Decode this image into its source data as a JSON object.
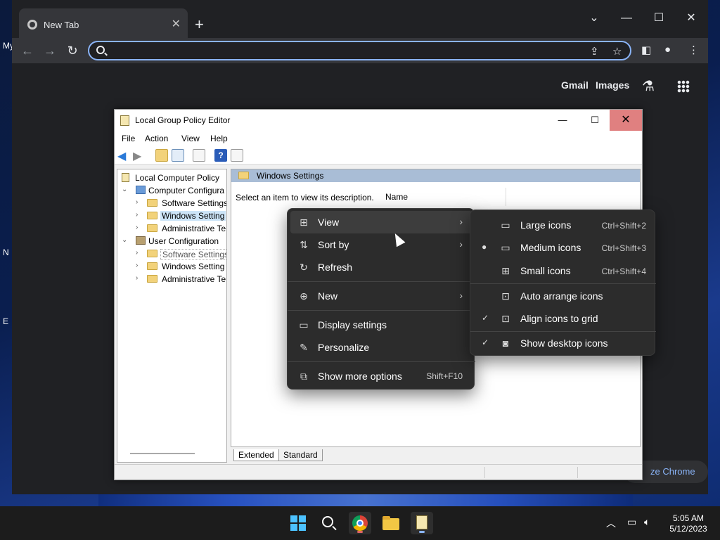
{
  "desktop": {
    "edge_text_1": "My",
    "edge_text_2": "N",
    "edge_text_3": "E"
  },
  "chrome": {
    "tab_title": "New Tab",
    "new_tab": "+",
    "gmail": "Gmail",
    "images": "Images",
    "customize": "ze Chrome",
    "accent": "#8ab4f8"
  },
  "gpedit": {
    "title": "Local Group Policy Editor",
    "menu": [
      "File",
      "Action",
      "View",
      "Help"
    ],
    "tree": {
      "root": "Local Computer Policy",
      "computer_config": "Computer Configura",
      "cc_software": "Software Settings",
      "cc_windows": "Windows Setting",
      "cc_admin": "Administrative Te",
      "user_config": "User Configuration",
      "uc_software": "Software Settings",
      "uc_windows": "Windows Setting",
      "uc_admin": "Administrative Te"
    },
    "detail_header": "Windows Settings",
    "detail_desc": "Select an item to view its description.",
    "column_name": "Name",
    "tabs": [
      "Extended",
      "Standard"
    ]
  },
  "context_menu": {
    "view": "View",
    "sort_by": "Sort by",
    "refresh": "Refresh",
    "new": "New",
    "display_settings": "Display settings",
    "personalize": "Personalize",
    "show_more": "Show more options",
    "show_more_shortcut": "Shift+F10"
  },
  "view_submenu": {
    "large": "Large icons",
    "large_sc": "Ctrl+Shift+2",
    "medium": "Medium icons",
    "medium_sc": "Ctrl+Shift+3",
    "small": "Small icons",
    "small_sc": "Ctrl+Shift+4",
    "auto_arrange": "Auto arrange icons",
    "align_grid": "Align icons to grid",
    "show_desktop": "Show desktop icons"
  },
  "taskbar": {
    "time": "5:05 AM",
    "date": "5/12/2023"
  }
}
